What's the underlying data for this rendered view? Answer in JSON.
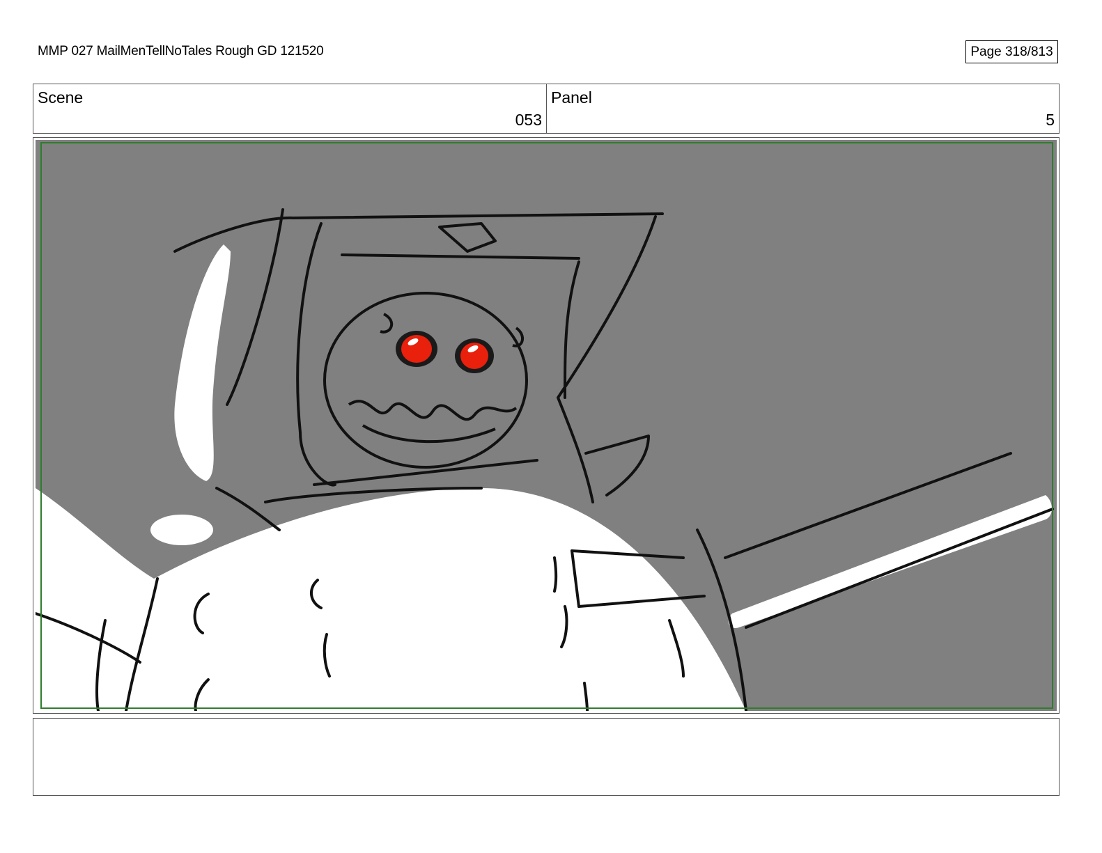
{
  "header": {
    "title": "MMP 027 MailMenTellNoTales Rough GD 121520",
    "page": "Page 318/813"
  },
  "info": {
    "scene_label": "Scene",
    "scene_value": "053",
    "panel_label": "Panel",
    "panel_value": "5"
  },
  "artwork": {
    "background_color": "#808080",
    "foreground_color": "#ffffff",
    "eye_color": "#e8200c",
    "safe_frame_color": "#2e7d2e"
  },
  "notes": {
    "text": ""
  }
}
